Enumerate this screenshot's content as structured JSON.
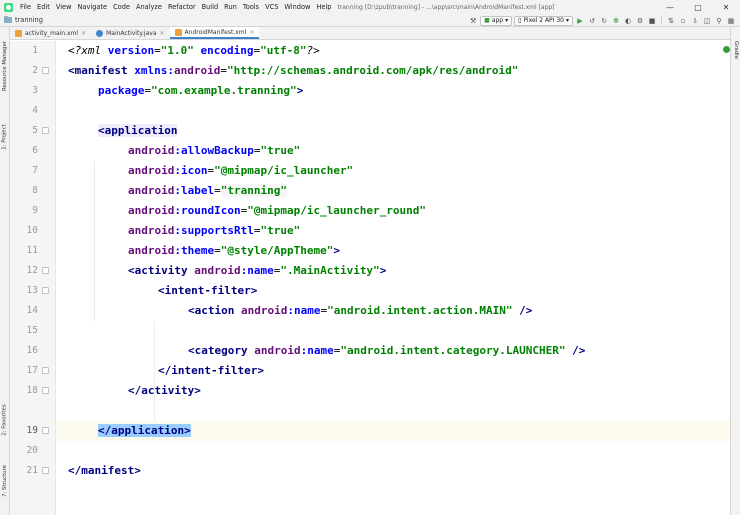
{
  "menubar": {
    "items": [
      "File",
      "Edit",
      "View",
      "Navigate",
      "Code",
      "Analyze",
      "Refactor",
      "Build",
      "Run",
      "Tools",
      "VCS",
      "Window",
      "Help"
    ],
    "window_title": "tranning [D:\\zpub\\tranning] - ...\\app\\src\\main\\AndroidManifest.xml [app]"
  },
  "navbar": {
    "project": "tranning",
    "run_config": "app",
    "device": "Pixel 2 API 30"
  },
  "left_strip": {
    "tabs": [
      "Resource Manager",
      "1: Project",
      "2: Favorites",
      "7: Structure"
    ]
  },
  "right_strip": {
    "tabs": [
      "Gradle"
    ]
  },
  "editor_tabs": [
    {
      "label": "activity_main.xml",
      "icon": "layout-xml-icon",
      "color": "#e8a33d"
    },
    {
      "label": "MainActivity.java",
      "icon": "java-class-icon",
      "color": "#3e86c9"
    },
    {
      "label": "AndroidManifest.xml",
      "icon": "manifest-icon",
      "color": "#e8a33d"
    }
  ],
  "code": {
    "line_numbers": [
      "1",
      "2",
      "3",
      "4",
      "5",
      "6",
      "7",
      "8",
      "9",
      "10",
      "11",
      "12",
      "13",
      "14",
      "15",
      "16",
      "17",
      "18",
      "19",
      "20",
      "21"
    ],
    "l1": {
      "a": "<?xml ",
      "b": "version",
      "c": "=",
      "d": "\"1.0\"",
      "e": " ",
      "f": "encoding",
      "g": "=",
      "h": "\"utf-8\"",
      "i": "?>"
    },
    "l2": {
      "a": "<manifest ",
      "b": "xmlns:",
      "c": "android",
      "d": "=",
      "e": "\"http://schemas.android.com/apk/res/android\""
    },
    "l3": {
      "a": "package",
      "b": "=",
      "c": "\"com.example.tranning\"",
      "d": ">"
    },
    "l5": {
      "a": "<application"
    },
    "l6": {
      "ns": "android",
      "attr": ":allowBackup",
      "eq": "=",
      "val": "\"true\""
    },
    "l7": {
      "ns": "android",
      "attr": ":icon",
      "eq": "=",
      "val": "\"@mipmap/ic_launcher\""
    },
    "l8": {
      "ns": "android",
      "attr": ":label",
      "eq": "=",
      "val": "\"tranning\""
    },
    "l9": {
      "ns": "android",
      "attr": ":roundIcon",
      "eq": "=",
      "val": "\"@mipmap/ic_launcher_round\""
    },
    "l10": {
      "ns": "android",
      "attr": ":supportsRtl",
      "eq": "=",
      "val": "\"true\""
    },
    "l11": {
      "ns": "android",
      "attr": ":theme",
      "eq": "=",
      "val": "\"@style/AppTheme\"",
      "end": ">"
    },
    "l12": {
      "tag": "<activity ",
      "ns": "android",
      "attr": ":name",
      "eq": "=",
      "val": "\".MainActivity\"",
      "end": ">"
    },
    "l13": {
      "tag": "<intent-filter>"
    },
    "l14": {
      "tag": "<action ",
      "ns": "android",
      "attr": ":name",
      "eq": "=",
      "val": "\"android.intent.action.MAIN\"",
      "end": " />"
    },
    "l16": {
      "tag": "<category ",
      "ns": "android",
      "attr": ":name",
      "eq": "=",
      "val": "\"android.intent.category.LAUNCHER\"",
      "end": " />"
    },
    "l17": {
      "tag": "</intent-filter>"
    },
    "l18": {
      "tag": "</activity>"
    },
    "l19": {
      "tag": "</application>"
    },
    "l21": {
      "tag": "</manifest>"
    }
  },
  "colors": {
    "tag": "#000080",
    "attribute": "#0000ff",
    "namespace": "#660e7a",
    "string": "#008000",
    "caret_line": "#fcfaed",
    "brace_match": "#99ccff",
    "active_tab_underline": "#4083c9"
  }
}
